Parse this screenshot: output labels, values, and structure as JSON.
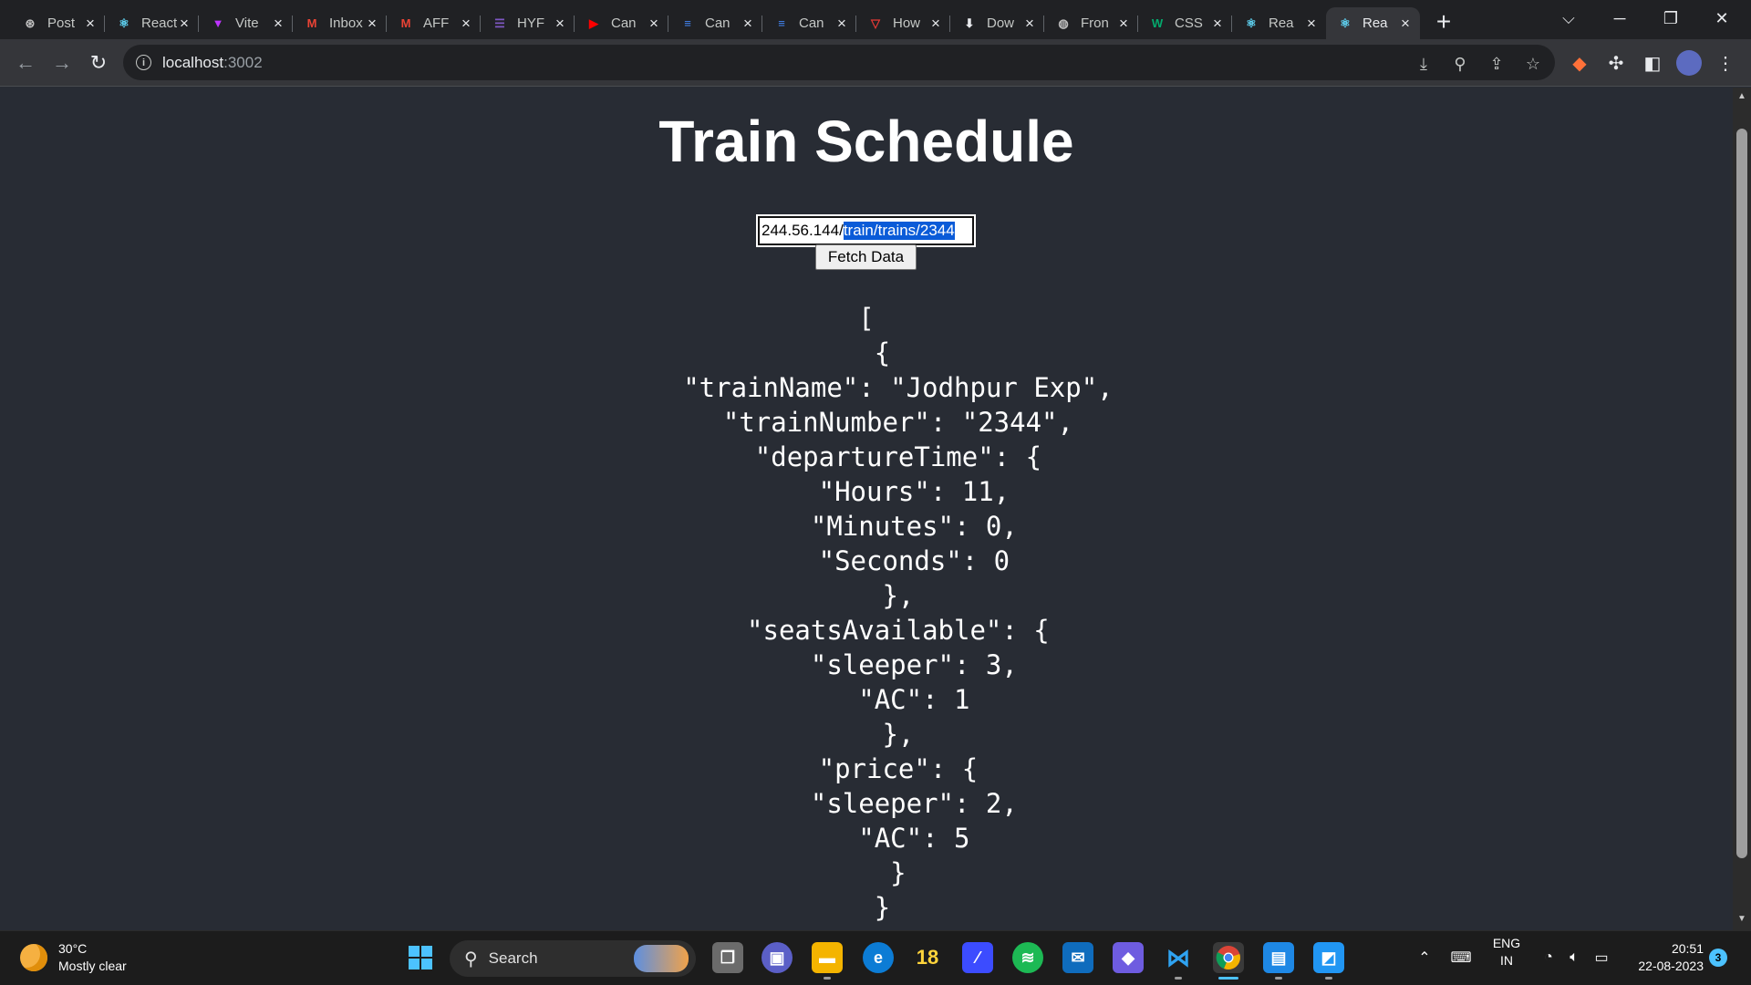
{
  "browser": {
    "tabs": [
      {
        "label": "Post",
        "icon": "openai-icon",
        "color": "#bfbfbf",
        "glyph": "⊛"
      },
      {
        "label": "React",
        "icon": "react-icon",
        "color": "#61dafb",
        "glyph": "⚛"
      },
      {
        "label": "Vite",
        "icon": "vite-icon",
        "color": "#bd34fe",
        "glyph": "▼"
      },
      {
        "label": "Inbox",
        "icon": "gmail-icon",
        "color": "#ea4335",
        "glyph": "M"
      },
      {
        "label": "AFF",
        "icon": "gmail-icon",
        "color": "#ea4335",
        "glyph": "M"
      },
      {
        "label": "HYF",
        "icon": "list-icon",
        "color": "#7e57c2",
        "glyph": "☰"
      },
      {
        "label": "Can",
        "icon": "youtube-icon",
        "color": "#ff0000",
        "glyph": "▶"
      },
      {
        "label": "Can",
        "icon": "docs-icon",
        "color": "#4285f4",
        "glyph": "≡"
      },
      {
        "label": "Can",
        "icon": "docs-icon",
        "color": "#4285f4",
        "glyph": "≡"
      },
      {
        "label": "How",
        "icon": "vercel-icon",
        "color": "#e53935",
        "glyph": "▽"
      },
      {
        "label": "Dow",
        "icon": "download-icon",
        "color": "#e8eaed",
        "glyph": "⬇"
      },
      {
        "label": "Fron",
        "icon": "globe-icon",
        "color": "#bdbdbd",
        "glyph": "◍"
      },
      {
        "label": "CSS",
        "icon": "w3schools-icon",
        "color": "#04aa6d",
        "glyph": "W"
      },
      {
        "label": "Rea",
        "icon": "react-icon",
        "color": "#61dafb",
        "glyph": "⚛"
      },
      {
        "label": "Rea",
        "icon": "react-icon",
        "color": "#61dafb",
        "glyph": "⚛"
      }
    ],
    "active_tab": 14,
    "address": {
      "host": "localhost",
      "port": ":3002"
    }
  },
  "page": {
    "title": "Train Schedule",
    "input": {
      "value_unselected": "244.56.144/",
      "value_selected": "train/trains/2344"
    },
    "fetch_button": "Fetch Data",
    "json_output": "[\n  {\n    \"trainName\": \"Jodhpur Exp\",\n    \"trainNumber\": \"2344\",\n    \"departureTime\": {\n      \"Hours\": 11,\n      \"Minutes\": 0,\n      \"Seconds\": 0\n    },\n    \"seatsAvailable\": {\n      \"sleeper\": 3,\n      \"AC\": 1\n    },\n    \"price\": {\n      \"sleeper\": 2,\n      \"AC\": 5\n    }\n  }"
  },
  "taskbar": {
    "weather": {
      "temp": "30°C",
      "desc": "Mostly clear"
    },
    "search_label": "Search",
    "language": {
      "line1": "ENG",
      "line2": "IN"
    },
    "clock": {
      "time": "20:51",
      "date": "22-08-2023"
    },
    "notifications": "3",
    "badge_18": "18"
  }
}
